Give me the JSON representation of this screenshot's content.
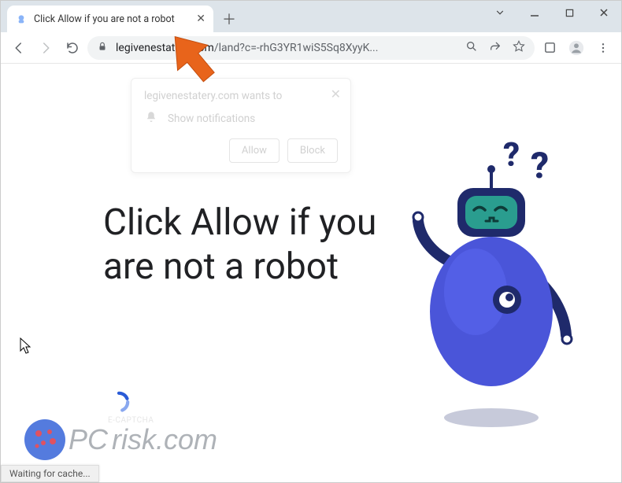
{
  "window": {
    "tab_title": "Click Allow if you are not a robot",
    "tab_dropdown": "▾"
  },
  "toolbar": {
    "url_host": "legivenestatery.com",
    "url_path": "/land?c=-rhG3YR1wiS5Sq8XyyK..."
  },
  "notification": {
    "title": "legivenestatery.com wants to",
    "item": "Show notifications",
    "allow": "Allow",
    "block": "Block"
  },
  "page": {
    "headline": "Click Allow if you are not a robot",
    "ecaptcha": "E-CAPTCHA"
  },
  "status": {
    "text": "Waiting for cache..."
  },
  "watermark": {
    "text": "risk.com"
  }
}
